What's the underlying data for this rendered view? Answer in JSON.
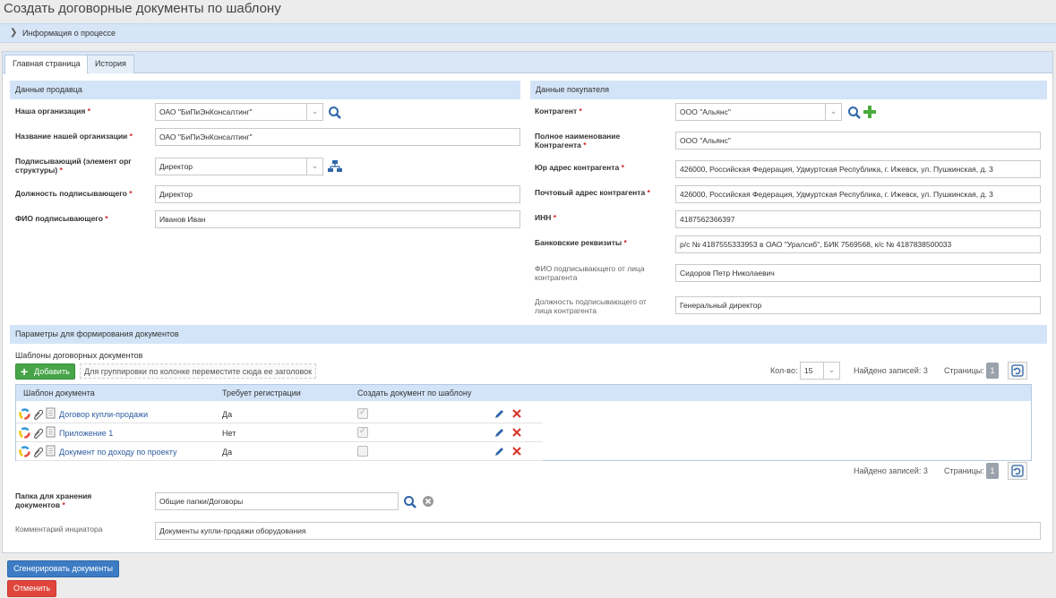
{
  "page": {
    "title": "Создать договорные документы по шаблону"
  },
  "info_bar": {
    "label": "Информация о процессе"
  },
  "tabs": [
    {
      "label": "Главная страница"
    },
    {
      "label": "История"
    }
  ],
  "seller": {
    "title": "Данные продавца",
    "our_org": {
      "label": "Наша организация",
      "value": "ОАО \"БиПиЭнКонсалтинг\""
    },
    "our_org_name": {
      "label": "Название нашей организации",
      "value": "ОАО \"БиПиЭнКонсалтинг\""
    },
    "signer_element": {
      "label_line1": "Подписывающий (элемент орг",
      "label_line2": "структуры)",
      "value": "Директор"
    },
    "signer_position": {
      "label": "Должность подписывающего",
      "value": "Директор"
    },
    "signer_name": {
      "label": "ФИО подписывающего",
      "value": "Иванов Иван"
    }
  },
  "buyer": {
    "title": "Данные покупателя",
    "counterparty": {
      "label": "Контрагент",
      "value": "ООО \"Альянс\""
    },
    "full_name": {
      "label_line1": "Полное наименование",
      "label_line2": "Контрагента",
      "value": "ООО \"Альянс\""
    },
    "legal_address": {
      "label": "Юр адрес контрагента",
      "value": "426000, Российская Федерация, Удмуртская Республика, г. Ижевск, ул. Пушкинская, д. 3"
    },
    "postal_address": {
      "label": "Почтовый адрес контрагента",
      "value": "426000, Российская Федерация, Удмуртская Республика, г. Ижевск, ул. Пушкинская, д. 3"
    },
    "inn": {
      "label": "ИНН",
      "value": "4187562366397"
    },
    "bank": {
      "label": "Банковские реквизиты",
      "value": "р/с № 4187555333953 в ОАО \"Уралсиб\", БИК 7569568, к/с № 4187838500033"
    },
    "signer_name": {
      "label_line1": "ФИО подписывающего от лица",
      "label_line2": "контрагента",
      "value": "Сидоров Петр Николаевич"
    },
    "signer_position": {
      "label_line1": "Должность подписывающего от",
      "label_line2": "лица контрагента",
      "value": "Генеральный директор"
    }
  },
  "params": {
    "title": "Параметры для формирования документов",
    "templates_label": "Шаблоны договорных документов",
    "add_button": "Добавить",
    "group_hint": "Для группировки по колонке переместите сюда ее заголовок",
    "qty_label": "Кол-во:",
    "qty_value": "15",
    "found_label": "Найдено записей: 3",
    "pages_label": "Страницы:",
    "page_number": "1",
    "columns": [
      "Шаблон документа",
      "Требует регистрации",
      "Создать документ по шаблону"
    ],
    "rows": [
      {
        "name": "Договор купли-продажи",
        "requires": "Да",
        "create": true
      },
      {
        "name": "Приложение 1",
        "requires": "Нет",
        "create": true
      },
      {
        "name": "Документ по доходу по проекту",
        "requires": "Да",
        "create": false
      }
    ],
    "folder": {
      "label_line1": "Папка для хранения",
      "label_line2": "документов",
      "value": "Общие папки/Договоры"
    },
    "comment": {
      "label": "Комментарий инциатора",
      "value": "Документы купли-продажи оборудования"
    }
  },
  "actions": {
    "generate": "Сгенерировать документы",
    "cancel": "Отменить"
  },
  "colors": {
    "accent": "#3d7cc4",
    "add": "#47a447",
    "danger": "#e0463c",
    "header_bg": "#d4e4f8"
  }
}
